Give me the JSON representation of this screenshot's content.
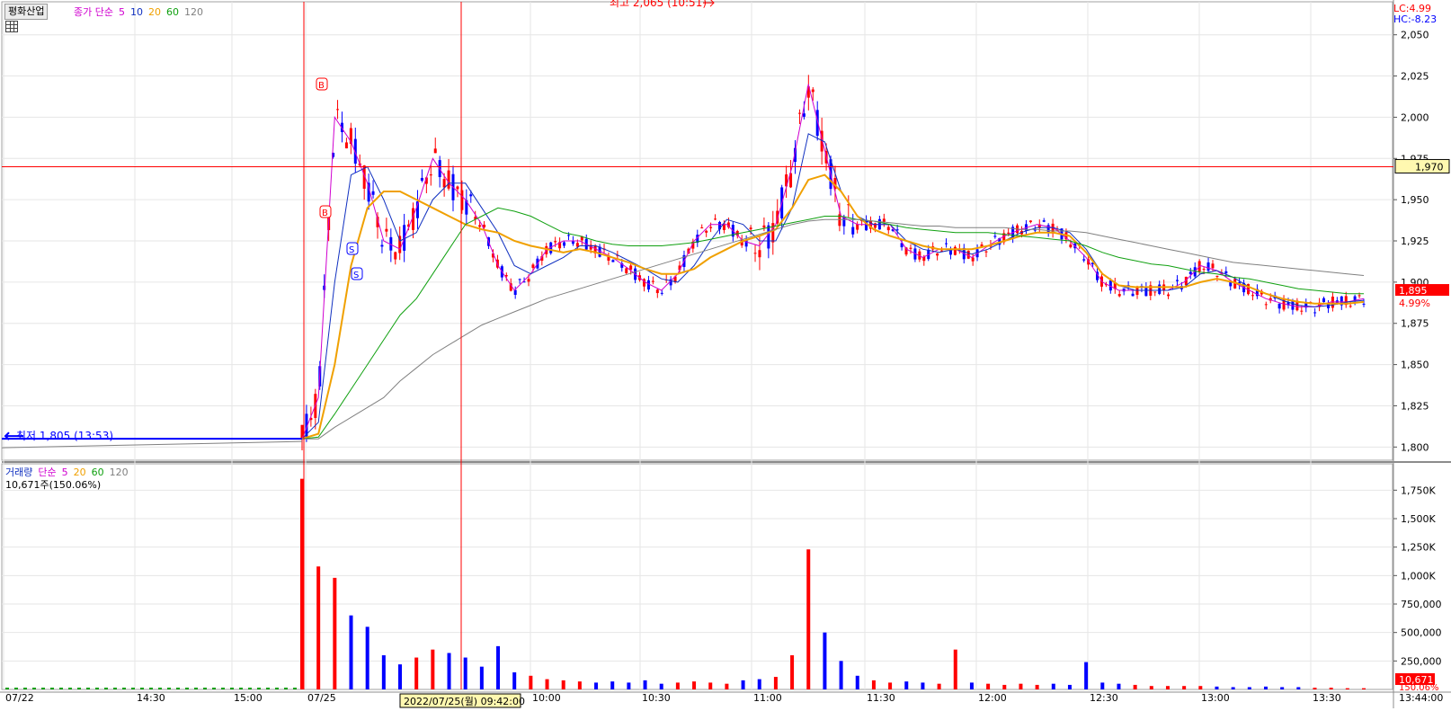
{
  "window": {
    "stock_name": "평화산업",
    "lc_label": "LC:4.99",
    "hc_label": "HC:-8.23"
  },
  "price_legend": {
    "label": "종가 단순",
    "periods": [
      "5",
      "10",
      "20",
      "60",
      "120"
    ],
    "colors": [
      "#d000d0",
      "#1030c0",
      "#f0a000",
      "#10a010",
      "#808080"
    ]
  },
  "volume_legend": {
    "label": "거래량",
    "ma_label": "단순",
    "periods": [
      "5",
      "20",
      "60",
      "120"
    ],
    "colors": [
      "#d000d0",
      "#f0a000",
      "#10a010",
      "#808080"
    ],
    "current": "10,671주(150.06%)"
  },
  "annotations": {
    "high": "최고 2,065 (10:51)",
    "low": "최저 1,805 (13:53)",
    "crosshair_price": "1,970",
    "crosshair_time": "2022/07/25(월) 09:42:00",
    "last_price": "1,895",
    "last_change": "4.99%",
    "last_volume": "10,671",
    "last_volume_pct": "150.06%",
    "time_end": "13:44:00",
    "buy_marker": "B",
    "sell_marker": "S"
  },
  "colors": {
    "up": "#ff0000",
    "down": "#0000ff",
    "crosshair": "#ff0000",
    "grid": "#e6e6e6"
  },
  "chart_data": {
    "type": "candlestick",
    "price_axis": {
      "ticks": [
        "2,050",
        "2,025",
        "2,000",
        "1,975",
        "1,950",
        "1,925",
        "1,900",
        "1,875",
        "1,850",
        "1,825",
        "1,800"
      ],
      "ylim": [
        1792,
        2070
      ]
    },
    "volume_axis": {
      "ticks": [
        "1,750K",
        "1,500K",
        "1,250K",
        "1,000K",
        "750,000",
        "500,000",
        "250,000"
      ],
      "ylim": [
        0,
        1950000
      ]
    },
    "x_ticks": [
      "07/22",
      "14:30",
      "15:00",
      "07/25",
      "10:00",
      "10:30",
      "11:00",
      "11:30",
      "12:00",
      "12:30",
      "13:00",
      "13:30"
    ],
    "prev_close": 1805,
    "high": 2065,
    "low": 1805,
    "last": 1895,
    "series": [
      {
        "name": "5",
        "values": [
          1805,
          1830,
          2000,
          1985,
          1960,
          1925,
          1920,
          1945,
          1975,
          1960,
          1950,
          1935,
          1910,
          1895,
          1905,
          1920,
          1925,
          1925,
          1920,
          1915,
          1908,
          1900,
          1895,
          1905,
          1925,
          1935,
          1935,
          1925,
          1922,
          1935,
          1970,
          2020,
          1980,
          1940,
          1935,
          1935,
          1935,
          1920,
          1915,
          1920,
          1920,
          1915,
          1922,
          1928,
          1932,
          1935,
          1933,
          1925,
          1915,
          1900,
          1895,
          1895,
          1895,
          1895,
          1900,
          1910,
          1907,
          1900,
          1895,
          1890,
          1887,
          1885,
          1885,
          1888,
          1888,
          1890
        ]
      },
      {
        "name": "10",
        "values": [
          1805,
          1815,
          1900,
          1965,
          1970,
          1950,
          1925,
          1930,
          1950,
          1960,
          1960,
          1945,
          1930,
          1910,
          1905,
          1910,
          1915,
          1922,
          1922,
          1918,
          1913,
          1908,
          1902,
          1900,
          1910,
          1925,
          1938,
          1935,
          1925,
          1925,
          1945,
          1990,
          1985,
          1955,
          1940,
          1935,
          1935,
          1925,
          1920,
          1918,
          1920,
          1917,
          1920,
          1925,
          1930,
          1933,
          1933,
          1930,
          1920,
          1905,
          1898,
          1895,
          1895,
          1895,
          1897,
          1905,
          1907,
          1903,
          1897,
          1893,
          1889,
          1886,
          1885,
          1886,
          1888,
          1889
        ]
      },
      {
        "name": "20",
        "values": [
          1805,
          1808,
          1850,
          1910,
          1945,
          1955,
          1955,
          1950,
          1945,
          1940,
          1935,
          1932,
          1930,
          1925,
          1922,
          1920,
          1918,
          1920,
          1918,
          1915,
          1912,
          1908,
          1905,
          1905,
          1908,
          1915,
          1920,
          1925,
          1928,
          1932,
          1945,
          1962,
          1965,
          1955,
          1940,
          1932,
          1928,
          1925,
          1922,
          1920,
          1920,
          1920,
          1922,
          1925,
          1928,
          1930,
          1930,
          1928,
          1918,
          1905,
          1898,
          1897,
          1897,
          1897,
          1897,
          1900,
          1902,
          1900,
          1897,
          1893,
          1890,
          1888,
          1887,
          1887,
          1887,
          1888
        ]
      },
      {
        "name": "60",
        "values": [
          1805,
          1806,
          1820,
          1835,
          1850,
          1865,
          1880,
          1890,
          1905,
          1920,
          1935,
          1940,
          1945,
          1943,
          1940,
          1935,
          1930,
          1928,
          1925,
          1923,
          1922,
          1922,
          1922,
          1923,
          1924,
          1926,
          1928,
          1930,
          1932,
          1934,
          1936,
          1938,
          1940,
          1940,
          1938,
          1937,
          1935,
          1933,
          1932,
          1931,
          1930,
          1930,
          1930,
          1929,
          1928,
          1927,
          1926,
          1925,
          1922,
          1918,
          1915,
          1913,
          1911,
          1910,
          1908,
          1906,
          1905,
          1903,
          1902,
          1900,
          1898,
          1896,
          1895,
          1894,
          1893,
          1893
        ]
      },
      {
        "name": "120",
        "values": [
          1805,
          1805,
          1812,
          1818,
          1824,
          1830,
          1840,
          1848,
          1856,
          1862,
          1868,
          1874,
          1878,
          1882,
          1886,
          1890,
          1893,
          1896,
          1899,
          1902,
          1905,
          1908,
          1911,
          1914,
          1917,
          1920,
          1923,
          1926,
          1929,
          1932,
          1935,
          1937,
          1938,
          1938,
          1938,
          1937,
          1936,
          1935,
          1934,
          1934,
          1933,
          1933,
          1933,
          1933,
          1932,
          1932,
          1931,
          1931,
          1930,
          1928,
          1926,
          1924,
          1922,
          1920,
          1918,
          1916,
          1914,
          1912,
          1911,
          1910,
          1909,
          1908,
          1907,
          1906,
          1905,
          1904
        ]
      }
    ],
    "volume_series": [
      {
        "name": "volume",
        "values": [
          1850000,
          1080000,
          980000,
          650000,
          550000,
          300000,
          220000,
          280000,
          350000,
          320000,
          280000,
          200000,
          380000,
          150000,
          120000,
          90000,
          80000,
          70000,
          60000,
          70000,
          60000,
          80000,
          50000,
          60000,
          70000,
          60000,
          50000,
          80000,
          90000,
          110000,
          300000,
          1230000,
          500000,
          250000,
          120000,
          80000,
          60000,
          70000,
          60000,
          50000,
          350000,
          60000,
          50000,
          40000,
          50000,
          40000,
          50000,
          40000,
          240000,
          60000,
          50000,
          40000,
          30000,
          30000,
          30000,
          30000,
          25000,
          20000,
          20000,
          25000,
          20000,
          20000,
          15000,
          15000,
          10671,
          10671
        ]
      }
    ]
  }
}
